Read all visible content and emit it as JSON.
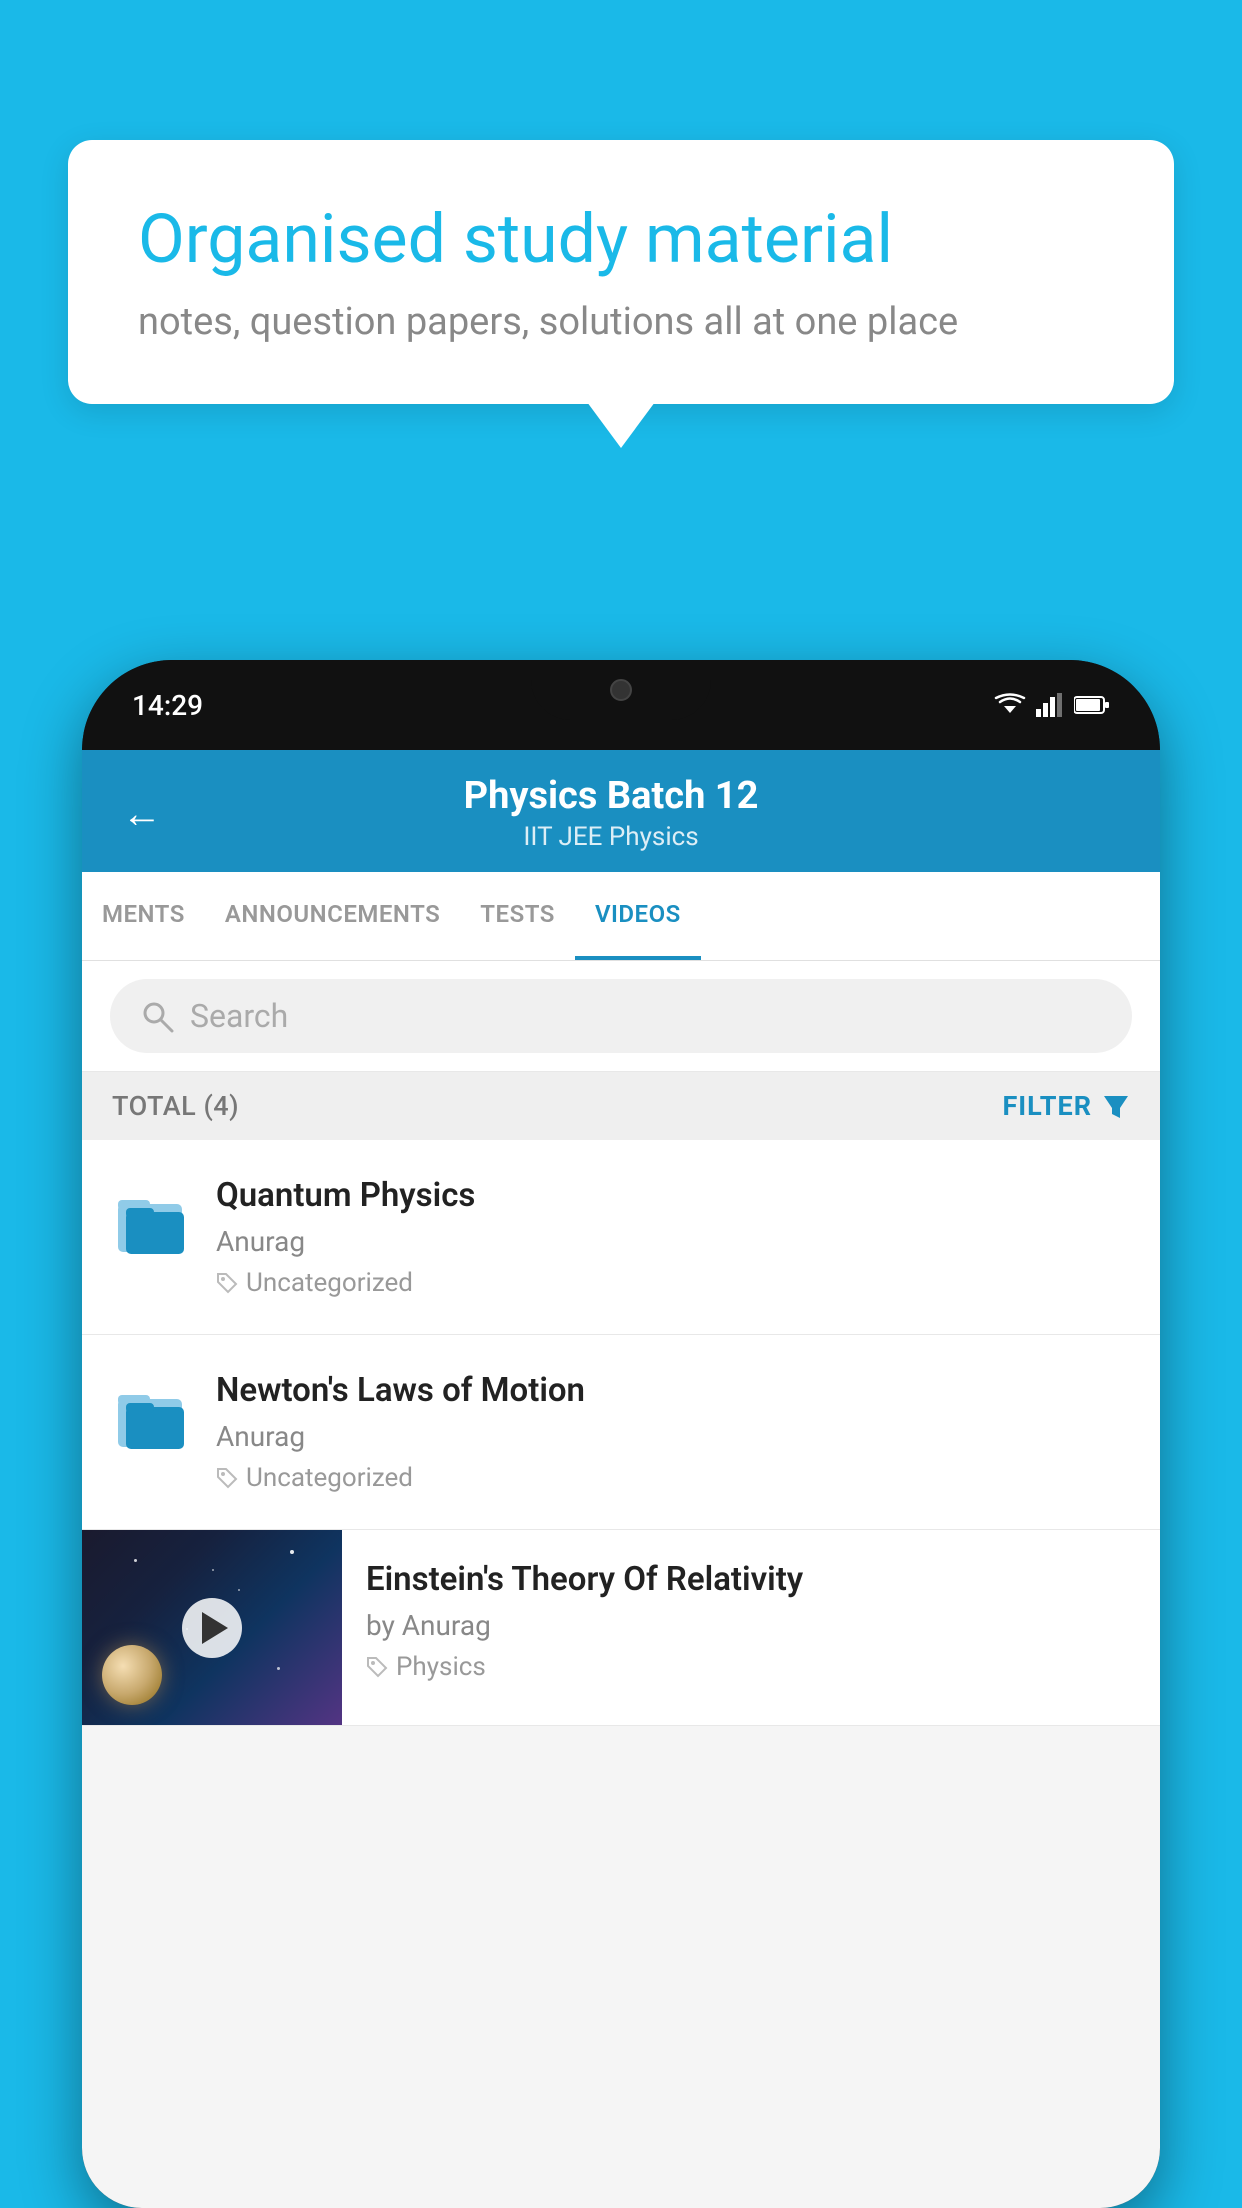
{
  "background": "#1ab9e8",
  "bubble": {
    "title": "Organised study material",
    "subtitle": "notes, question papers, solutions all at one place"
  },
  "phone": {
    "time": "14:29",
    "header": {
      "title": "Physics Batch 12",
      "subtitle": "IIT JEE   Physics",
      "back_label": "←"
    },
    "tabs": [
      {
        "label": "MENTS",
        "active": false
      },
      {
        "label": "ANNOUNCEMENTS",
        "active": false
      },
      {
        "label": "TESTS",
        "active": false
      },
      {
        "label": "VIDEOS",
        "active": true
      }
    ],
    "search": {
      "placeholder": "Search"
    },
    "filter": {
      "total_label": "TOTAL (4)",
      "button_label": "FILTER"
    },
    "items": [
      {
        "title": "Quantum Physics",
        "author": "Anurag",
        "tag": "Uncategorized",
        "type": "folder"
      },
      {
        "title": "Newton's Laws of Motion",
        "author": "Anurag",
        "tag": "Uncategorized",
        "type": "folder"
      },
      {
        "title": "Einstein's Theory Of Relativity",
        "author": "by Anurag",
        "tag": "Physics",
        "type": "video"
      }
    ]
  }
}
